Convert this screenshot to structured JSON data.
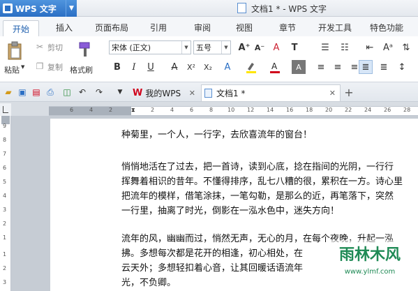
{
  "app": {
    "name": "WPS 文字",
    "window_title": "文档1 * - WPS 文字"
  },
  "tabs": [
    "开始",
    "插入",
    "页面布局",
    "引用",
    "审阅",
    "视图",
    "章节",
    "开发工具",
    "特色功能"
  ],
  "ribbon": {
    "paste": "粘贴",
    "cut": "剪切",
    "copy": "复制",
    "format_painter": "格式刷",
    "font_name": "宋体 (正文)",
    "font_size": "五号"
  },
  "doc_tabs": {
    "my_wps": "我的WPS",
    "doc1": "文档1 *"
  },
  "ruler": {
    "h_numbers": [
      "6",
      "4",
      "2",
      "2",
      "4",
      "6",
      "8",
      "10",
      "12",
      "14",
      "16",
      "18",
      "20",
      "22",
      "24",
      "26",
      "28"
    ],
    "v_numbers": [
      "9",
      "8",
      "7",
      "6",
      "5",
      "4",
      "3",
      "2",
      "1",
      "1",
      "2",
      "3"
    ]
  },
  "document": {
    "lines": [
      "种菊里，一个人，一行字，去欣喜流年的窗台！",
      "",
      "悄悄地活在了过去，把一首诗，读到心底，捻在指间的光阴，一行行",
      "挥舞着相识的昔年。不懂得排序，乱七八糟的很，累积在一方。诗心里",
      "把流年的模样，借笔涂抹，一笔勾勒，是那么的近，再笔落下，突然",
      "一行里，抽离了时光，倒影在一泓水色中，迷失方向！",
      "",
      "流年的风，幽幽而过，悄然无声，无心的月，在每个夜晚，升起一泓",
      "拂。多想每次都是花开的相逢，初心相处，在",
      "云天外；多想轻扣着心音，让其回暖话语流年",
      "光，不负卿。"
    ]
  },
  "watermark": {
    "text": "雨林木风",
    "url": "www.ylmf.com"
  }
}
